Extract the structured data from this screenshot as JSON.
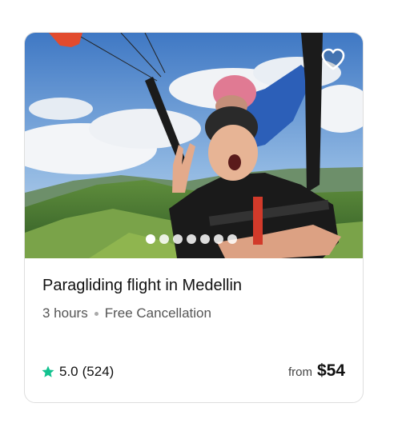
{
  "activity": {
    "title": "Paragliding flight in Medellin",
    "duration": "3 hours",
    "cancellation": "Free Cancellation",
    "rating": "5.0",
    "review_count": "(524)",
    "price_prefix": "from",
    "price": "$54"
  },
  "carousel": {
    "dot_count": 7,
    "active_index": 0
  },
  "icons": {
    "favorite": "heart-outline-icon",
    "rating": "star-icon"
  },
  "colors": {
    "star": "#12c28f",
    "title": "#111111",
    "meta": "#555555"
  }
}
